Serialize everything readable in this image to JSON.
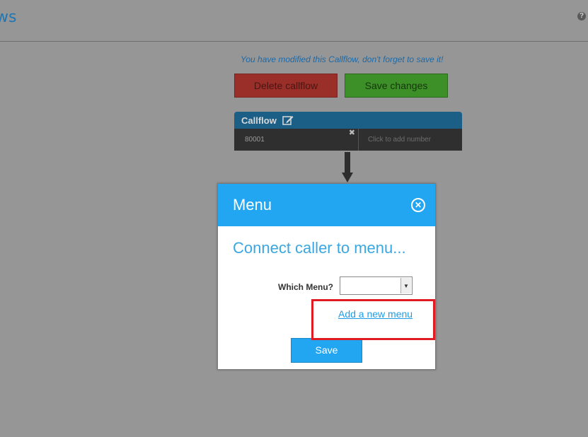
{
  "page": {
    "title": "ws",
    "help_icon": "question-icon"
  },
  "callflow": {
    "notice": "You have modified this Callflow, don't forget to save it!",
    "delete_label": "Delete callflow",
    "save_changes_label": "Save changes",
    "header": "Callflow",
    "edit_icon": "pencil-edit-icon",
    "number": "80001",
    "remove_symbol": "✖",
    "add_number_placeholder": "Click to add number"
  },
  "modal": {
    "title": "Menu",
    "close_symbol": "✕",
    "subtitle": "Connect caller to menu...",
    "which_menu_label": "Which Menu?",
    "selected_menu": "",
    "add_menu_link": "Add a new menu",
    "save_label": "Save"
  },
  "colors": {
    "modal_header": "#22a6f2",
    "highlight": "#e01b24",
    "delete_button": "#9a2f2a",
    "save_changes_button": "#3d8f27"
  }
}
